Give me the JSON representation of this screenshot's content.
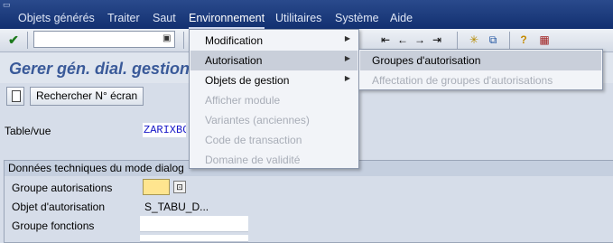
{
  "menubar": {
    "items": [
      "Objets générés",
      "Traiter",
      "Saut",
      "Environnement",
      "Utilitaires",
      "Système",
      "Aide"
    ],
    "active_index": 3
  },
  "toolbar": {
    "command_field_value": "",
    "icons": [
      "check-icon",
      "page-first-icon",
      "page-prev-icon",
      "page-next-icon",
      "page-last-icon",
      "layout-icon",
      "help-icon",
      "customize-icon"
    ]
  },
  "title": "Gerer gén. dial. gestion",
  "apptoolbar": {
    "search_screen_label": "Rechercher N° écran"
  },
  "fields": {
    "table_label": "Table/vue",
    "table_value": "ZARIXBC",
    "group_title": "Données techniques du mode dialog",
    "auth_group_label": "Groupe autorisations",
    "auth_object_label": "Objet d'autorisation",
    "auth_object_value": "S_TABU_D...",
    "function_group_label": "Groupe fonctions"
  },
  "dropdown": {
    "items": [
      {
        "label": "Modification",
        "submenu": true,
        "enabled": true,
        "highlighted": false
      },
      {
        "label": "Autorisation",
        "submenu": true,
        "enabled": true,
        "highlighted": true
      },
      {
        "label": "Objets de gestion",
        "submenu": true,
        "enabled": true,
        "highlighted": false
      },
      {
        "label": "Afficher module",
        "submenu": false,
        "enabled": false,
        "highlighted": false
      },
      {
        "label": "Variantes (anciennes)",
        "submenu": false,
        "enabled": false,
        "highlighted": false
      },
      {
        "label": "Code de transaction",
        "submenu": false,
        "enabled": false,
        "highlighted": false
      },
      {
        "label": "Domaine de validité",
        "submenu": false,
        "enabled": false,
        "highlighted": false
      }
    ]
  },
  "submenu": {
    "items": [
      {
        "label": "Groupes d'autorisation",
        "enabled": true,
        "highlighted": true
      },
      {
        "label": "Affectation de groupes d'autorisations",
        "enabled": false,
        "highlighted": false
      }
    ]
  }
}
